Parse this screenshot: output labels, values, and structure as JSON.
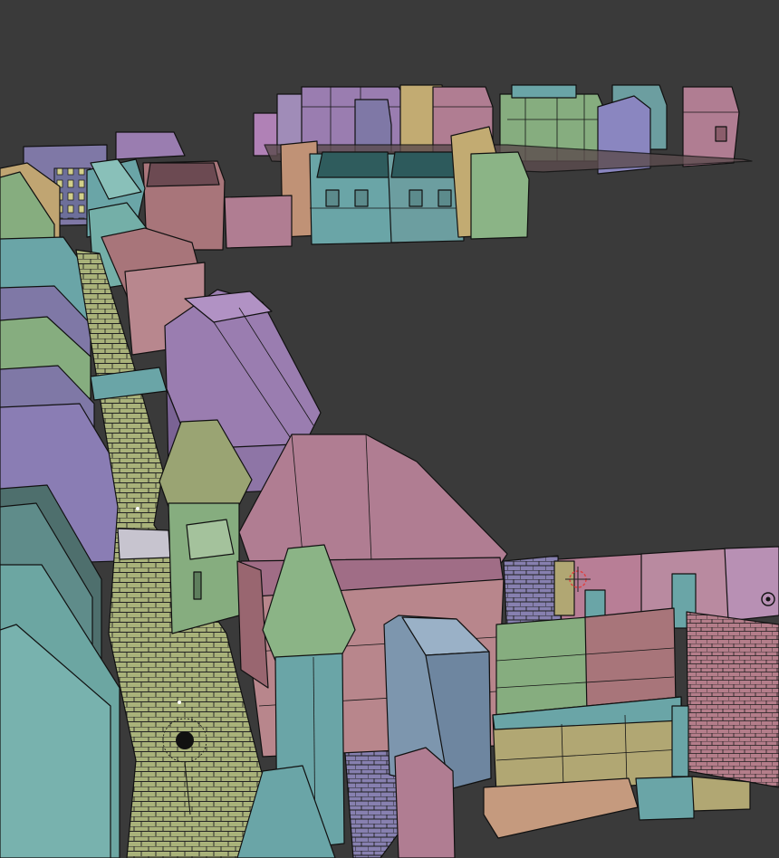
{
  "scene": {
    "background_color": "#3a3a3a",
    "palette": {
      "pink": "#b07d92",
      "rose": "#a8757a",
      "purple": "#9a7db0",
      "violet": "#7f78a6",
      "teal": "#6c9ea0",
      "cyan": "#6aa5a7",
      "green": "#86ad7f",
      "olive": "#9aa473",
      "yellow": "#b1a773",
      "slate": "#5f8c8a",
      "steel": "#7d96ae",
      "peach": "#c59a7e"
    },
    "icons": [
      "3d-cursor-icon",
      "object-origin-icon",
      "light-gizmo-icon"
    ]
  }
}
